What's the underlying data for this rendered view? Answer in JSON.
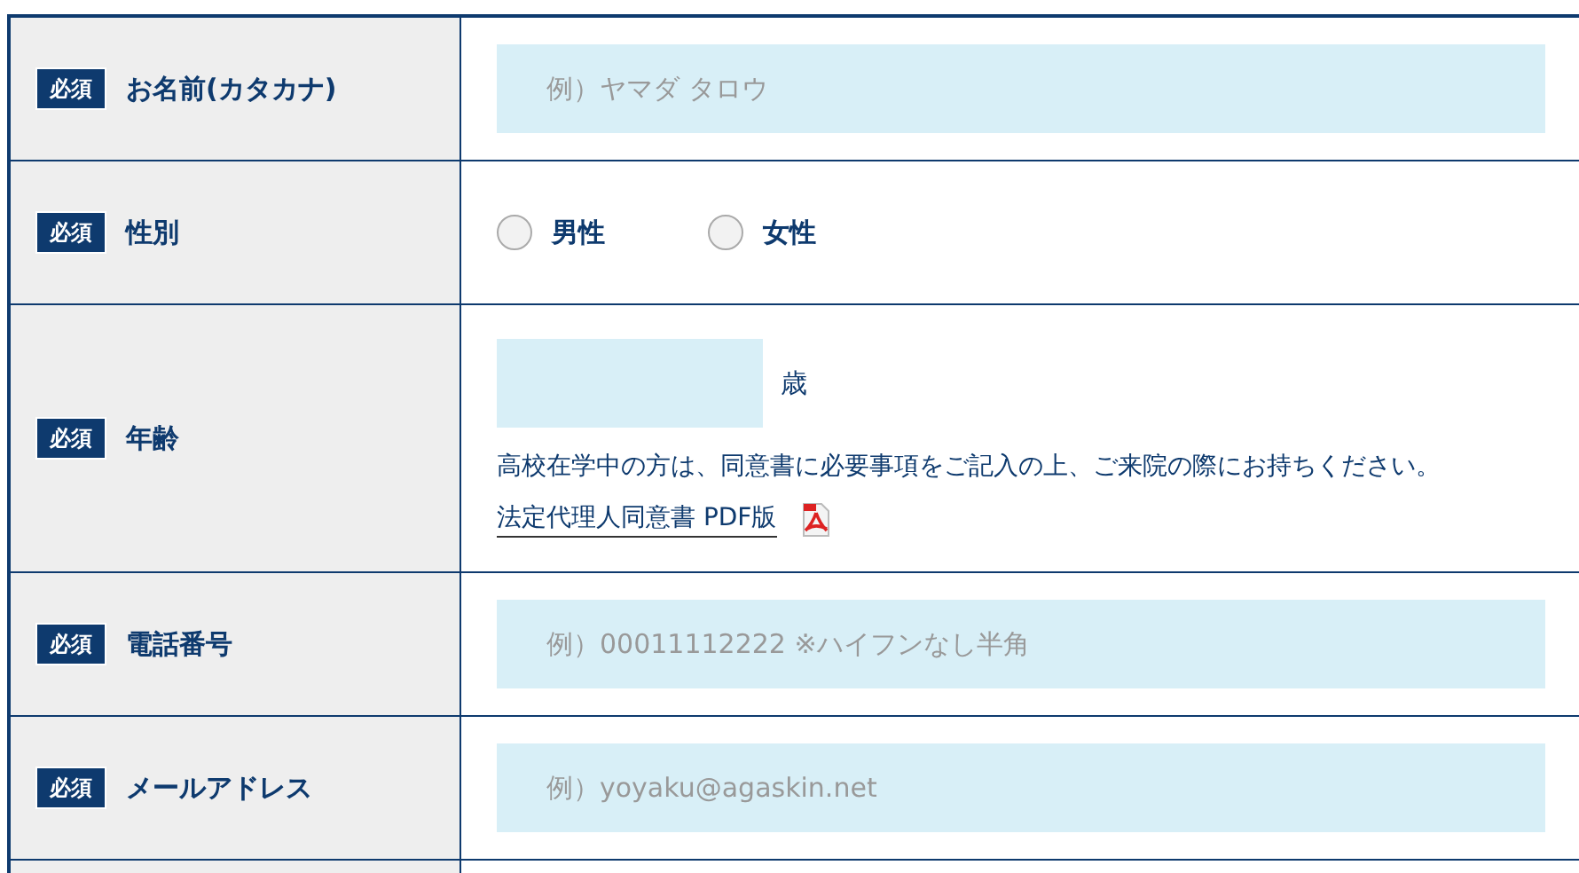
{
  "rows": [
    {
      "kind": "text",
      "badge": "必須",
      "label": "お名前(カタカナ)",
      "placeholder": "例）ヤマダ タロウ"
    },
    {
      "kind": "radio",
      "badge": "必須",
      "label": "性別",
      "options": [
        {
          "label": "男性",
          "selected": false
        },
        {
          "label": "女性",
          "selected": false
        }
      ]
    },
    {
      "kind": "age",
      "badge": "必須",
      "label": "年齢",
      "unit": "歳",
      "note": "高校在学中の方は、同意書に必要事項をご記入の上、ご来院の際にお持ちください。",
      "link": "法定代理人同意書 PDF版"
    },
    {
      "kind": "text",
      "badge": "必須",
      "label": "電話番号",
      "placeholder": "例）00011112222 ※ハイフンなし半角"
    },
    {
      "kind": "text",
      "badge": "必須",
      "label": "メールアドレス",
      "placeholder": "例）yoyaku@agaskin.net"
    }
  ]
}
